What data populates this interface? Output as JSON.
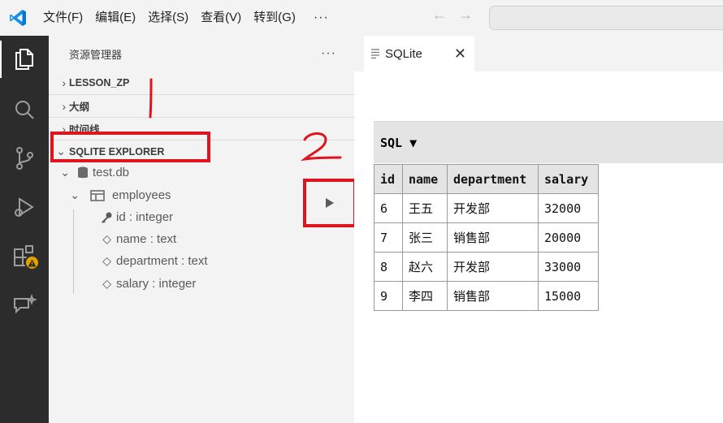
{
  "menu": [
    "文件(F)",
    "编辑(E)",
    "选择(S)",
    "查看(V)",
    "转到(G)"
  ],
  "menu_more": "···",
  "nav": {
    "back": "←",
    "forward": "→"
  },
  "sidebar": {
    "title": "资源管理器",
    "more": "···",
    "sections": [
      "LESSON_ZP",
      "大纲",
      "时间线",
      "SQLITE EXPLORER"
    ],
    "tree": {
      "db": "test.db",
      "table": "employees",
      "columns": [
        "id : integer",
        "name : text",
        "department : text",
        "salary : integer"
      ]
    }
  },
  "annotations": {
    "one": "1",
    "two": "2"
  },
  "editor": {
    "tab_label": "SQLite",
    "tab_close": "✕",
    "sql_label": "SQL ▼",
    "columns": [
      "id",
      "name",
      "department",
      "salary"
    ],
    "rows": [
      [
        "6",
        "王五",
        "开发部",
        "32000"
      ],
      [
        "7",
        "张三",
        "销售部",
        "20000"
      ],
      [
        "8",
        "赵六",
        "开发部",
        "33000"
      ],
      [
        "9",
        "李四",
        "销售部",
        "15000"
      ]
    ]
  },
  "colors": {
    "accent_red": "#e0141e",
    "vscode_blue": "#0078d4",
    "activity_bg": "#2c2c2c"
  }
}
